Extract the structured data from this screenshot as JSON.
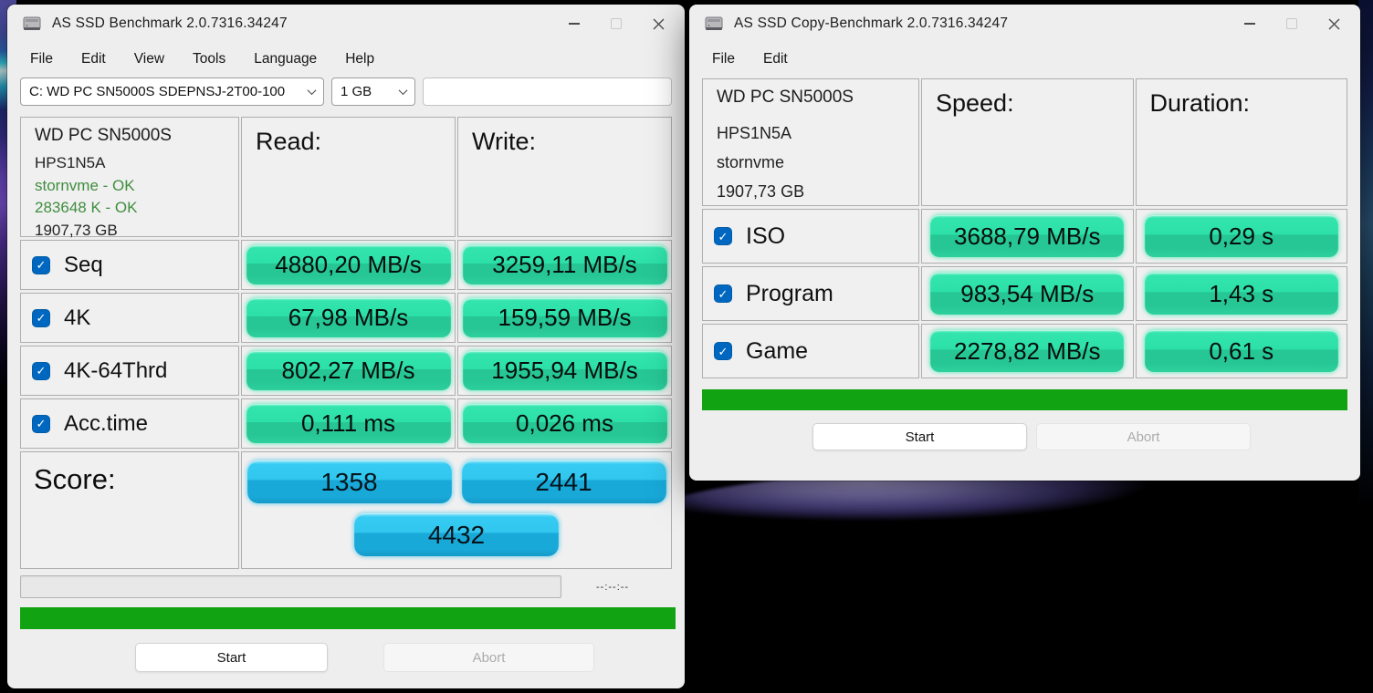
{
  "colors": {
    "result_pill_green": "#2BE0A6",
    "score_pill_blue": "#2BC4EE",
    "progress_green": "#12A312",
    "checkbox_blue": "#0067C0",
    "drive_ok_green": "#3E8E3E"
  },
  "benchmark_window": {
    "title": "AS SSD Benchmark 2.0.7316.34247",
    "menu": [
      "File",
      "Edit",
      "View",
      "Tools",
      "Language",
      "Help"
    ],
    "drive_select": "C: WD PC SN5000S SDEPNSJ-2T00-100",
    "size_select": "1 GB",
    "drive_info": {
      "model": "WD PC SN5000S",
      "firmware": "HPS1N5A",
      "driver_status": "stornvme - OK",
      "alignment_status": "283648 K - OK",
      "capacity": "1907,73 GB"
    },
    "read_header": "Read:",
    "write_header": "Write:",
    "rows": [
      {
        "label": "Seq",
        "read": "4880,20 MB/s",
        "write": "3259,11 MB/s"
      },
      {
        "label": "4K",
        "read": "67,98 MB/s",
        "write": "159,59 MB/s"
      },
      {
        "label": "4K-64Thrd",
        "read": "802,27 MB/s",
        "write": "1955,94 MB/s"
      },
      {
        "label": "Acc.time",
        "read": "0,111 ms",
        "write": "0,026 ms"
      }
    ],
    "score_label": "Score:",
    "read_score": "1358",
    "write_score": "2441",
    "total_score": "4432",
    "time_display": "--:--:--",
    "start_label": "Start",
    "abort_label": "Abort"
  },
  "copy_window": {
    "title": "AS SSD Copy-Benchmark 2.0.7316.34247",
    "menu": [
      "File",
      "Edit"
    ],
    "drive_info": {
      "model": "WD PC SN5000S",
      "firmware": "HPS1N5A",
      "driver": "stornvme",
      "capacity": "1907,73 GB"
    },
    "speed_header": "Speed:",
    "duration_header": "Duration:",
    "rows": [
      {
        "label": "ISO",
        "speed": "3688,79 MB/s",
        "duration": "0,29 s"
      },
      {
        "label": "Program",
        "speed": "983,54 MB/s",
        "duration": "1,43 s"
      },
      {
        "label": "Game",
        "speed": "2278,82 MB/s",
        "duration": "0,61 s"
      }
    ],
    "start_label": "Start",
    "abort_label": "Abort"
  }
}
